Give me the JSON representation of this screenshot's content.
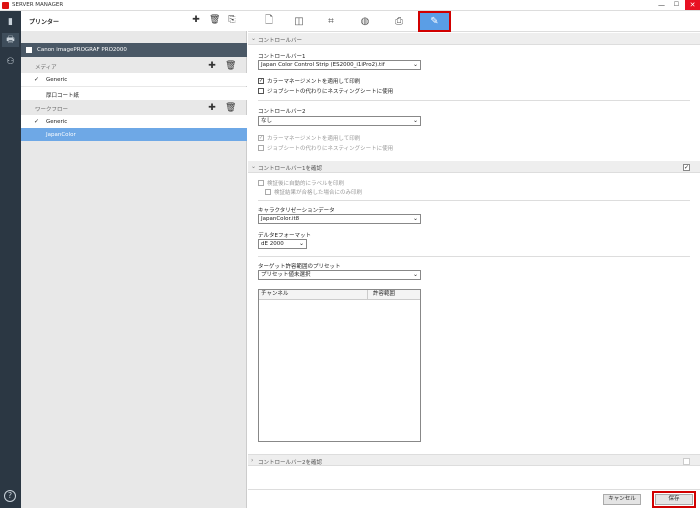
{
  "window": {
    "title": "SERVER MANAGER",
    "minimize": "—",
    "maximize": "☐",
    "close": "✕"
  },
  "leftbar": {
    "help": "?"
  },
  "sidebar": {
    "header": "プリンター",
    "printer": "Canon imagePROGRAF PRO2000",
    "media_label": "メディア",
    "media_items": [
      {
        "label": "Generic",
        "checked": true
      },
      {
        "label": "厚口コート紙",
        "checked": false
      }
    ],
    "workflow_label": "ワークフロー",
    "workflow_items": [
      {
        "label": "Generic",
        "checked": true
      },
      {
        "label": "JapanColor",
        "selected": true
      }
    ]
  },
  "main": {
    "section1": {
      "title": "コントロールバー",
      "cb1_label": "コントロールバー1",
      "cb1_value": "Japan Color Control Strip (ES2000_i1iPro2).tif",
      "cb1_check1": "カラーマネージメントを適用して印刷",
      "cb1_check2": "ジョブシートの代わりにネスティングシートに使用",
      "cb2_label": "コントロールバー2",
      "cb2_value": "なし",
      "cb2_check1": "カラーマネージメントを適用して印刷",
      "cb2_check2": "ジョブシートの代わりにネスティングシートに使用"
    },
    "section2": {
      "title": "コントロールバー1を確認",
      "auto_label": "検証後に自動的にラベルを印刷",
      "fail_label": "検証結果が合格した場合にのみ印刷",
      "calib_label": "キャラクタリゼーションデータ",
      "calib_value": "JapanColor.it8",
      "delta_label": "デルタEフォーマット",
      "delta_value": "dE 2000",
      "preset_label": "ターゲット許容範囲のプリセット",
      "preset_value": "プリセット値未選択",
      "table_headers": [
        "チャンネル",
        "許容範囲"
      ]
    },
    "section3": {
      "title": "コントロールバー2を確認"
    },
    "footer": {
      "cancel": "キャンセル",
      "save": "保存"
    }
  }
}
